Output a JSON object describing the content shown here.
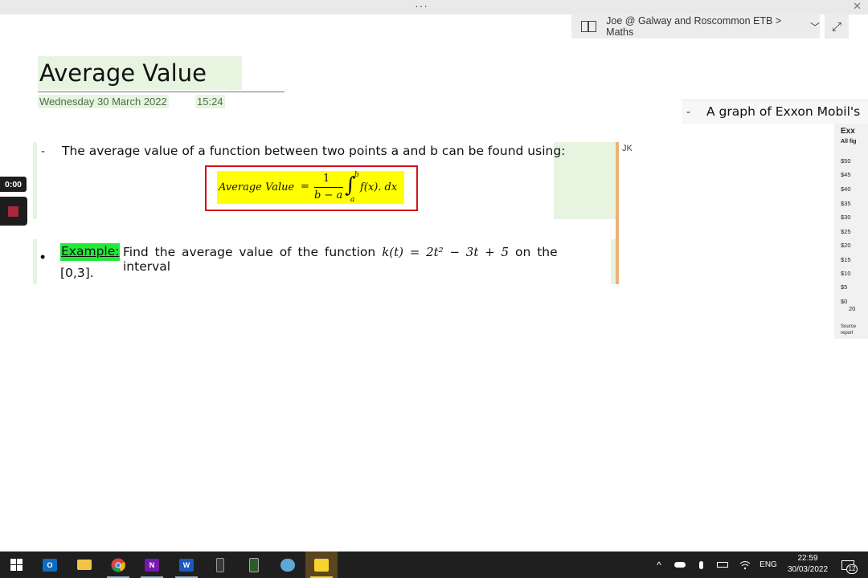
{
  "window": {
    "menu_dots": "···",
    "close_glyph": "✕"
  },
  "breadcrumb": {
    "text": "Joe @ Galway and Roscommon ETB > Maths",
    "chevron": "﹀",
    "expand_glyph": "⤢"
  },
  "page": {
    "title": "Average Value",
    "date": "Wednesday 30 March 2022",
    "time": "15:24"
  },
  "note1": {
    "dash": "-",
    "text": "The average value of a function between two points a and b can be found using:",
    "author_initials": "JK",
    "formula": {
      "lhs": "Average Value",
      "equals": "=",
      "numerator": "1",
      "denominator": "b − a",
      "integral": "∫",
      "upper": "b",
      "lower": "a",
      "integrand": "f(x). dx"
    }
  },
  "example": {
    "bullet": "•",
    "label": "Example:",
    "text_before": "Find the average value of the function",
    "function": "k(t) = 2t² − 3t + 5",
    "text_after": "on the interval",
    "line2": "[0,3]."
  },
  "recorder": {
    "elapsed": "0:00"
  },
  "side_note": {
    "dash": "-",
    "text": "A graph of Exxon Mobil's",
    "graph_title": "Exx",
    "graph_subtitle": "All fig",
    "ticks": [
      "$50",
      "$45",
      "$40",
      "$35",
      "$30",
      "$25",
      "$20",
      "$15",
      "$10",
      "$5",
      "$0"
    ],
    "x_label": "20",
    "source": [
      "Source",
      "report"
    ]
  },
  "taskbar": {
    "apps": [
      "start",
      "outlook",
      "file-explorer",
      "chrome",
      "onenote",
      "word",
      "calculator",
      "calculator-2",
      "remote",
      "sticky-notes"
    ],
    "language": "ENG",
    "clock_time": "22:59",
    "clock_date": "30/03/2022",
    "notification_count": "12"
  },
  "colors": {
    "note_tag_green": "#e6f4e0",
    "formula_highlight": "#ffff00",
    "formula_border": "#d4121c",
    "example_highlight": "#22e83a",
    "author_bar": "#eab27a",
    "recorder_stop": "#a62a3c",
    "taskbar": "#1f1f1f"
  }
}
